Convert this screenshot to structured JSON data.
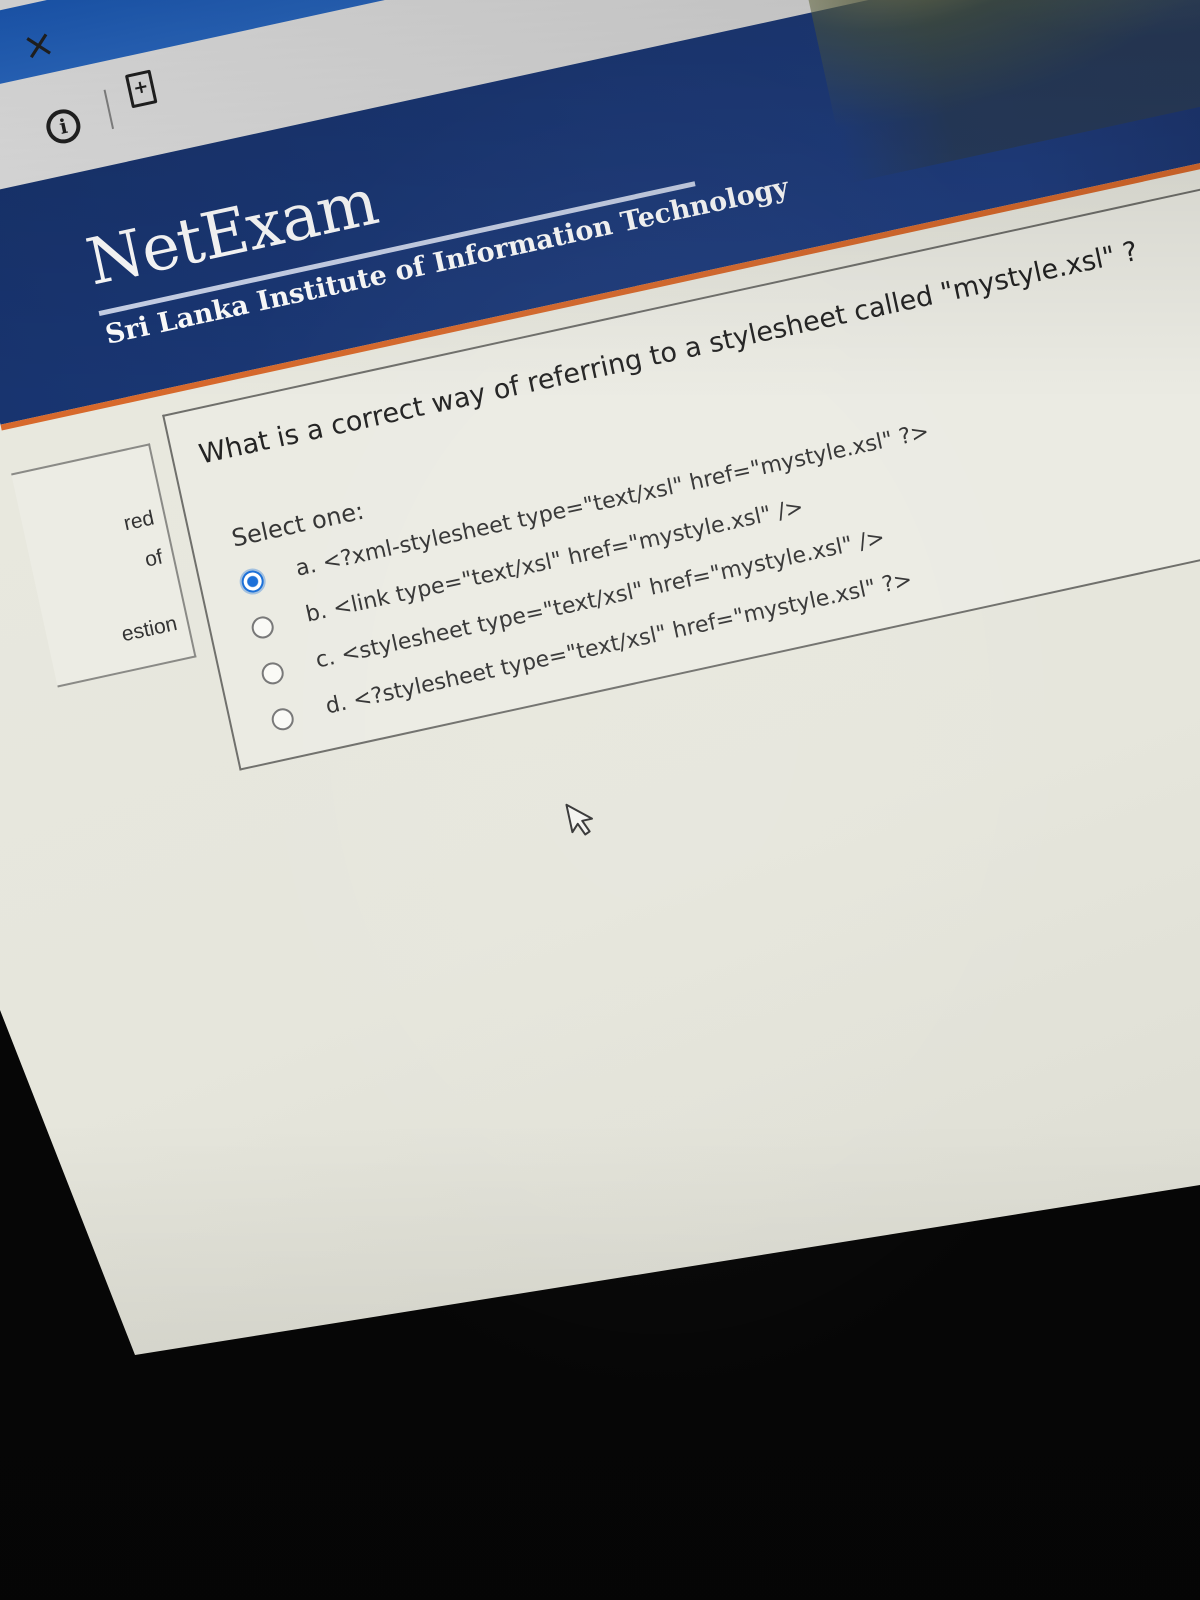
{
  "browser": {
    "close_glyph": "×",
    "info_icon": "i",
    "new_tab_icon": "+"
  },
  "site": {
    "logo": "NetExam",
    "institute": "Sri Lanka Institute of Information Technology",
    "banner_color": "#1d3b7c",
    "accent_color": "#d7692c"
  },
  "sidebar": {
    "fragments": [
      "red",
      "of",
      "estion"
    ]
  },
  "question": {
    "text": "What is a correct way of referring to a stylesheet called \"mystyle.xsl\" ?",
    "prompt": "Select one:",
    "options": [
      {
        "label": "a. <?xml-stylesheet type=\"text/xsl\" href=\"mystyle.xsl\" ?>",
        "selected": true
      },
      {
        "label": "b. <link type=\"text/xsl\" href=\"mystyle.xsl\" />",
        "selected": false
      },
      {
        "label": "c. <stylesheet type=\"text/xsl\" href=\"mystyle.xsl\" />",
        "selected": false
      },
      {
        "label": "d. <?stylesheet type=\"text/xsl\" href=\"mystyle.xsl\" ?>",
        "selected": false
      }
    ]
  },
  "radio_selected_color": "#1a6fd8"
}
